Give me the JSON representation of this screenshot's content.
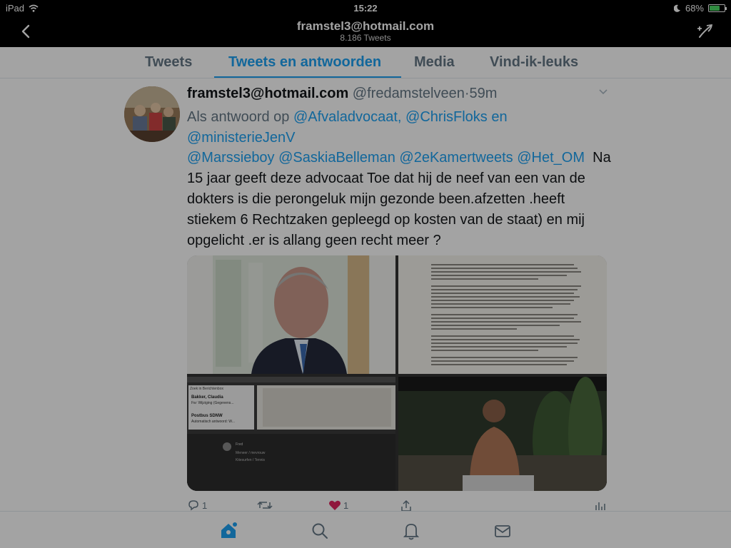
{
  "status_bar": {
    "device": "iPad",
    "time": "15:22",
    "battery": "68%",
    "battery_level": 0.68
  },
  "nav": {
    "title": "framstel3@hotmail.com",
    "subtitle": "8.186 Tweets"
  },
  "tabs": [
    {
      "label": "Tweets",
      "active": false
    },
    {
      "label": "Tweets en antwoorden",
      "active": true
    },
    {
      "label": "Media",
      "active": false
    },
    {
      "label": "Vind-ik-leuks",
      "active": false
    }
  ],
  "tweet": {
    "display_name": "framstel3@hotmail.com",
    "handle": "@fredamstelveen",
    "time": "59m",
    "reply_prefix": "Als antwoord op",
    "reply_mentions": [
      "@Afvaladvocaat,",
      "@ChrisFloks",
      "en",
      "@ministerieJenV"
    ],
    "body_mentions": [
      "@Marssieboy",
      "@SaskiaBelleman",
      "@2eKamertweets",
      "@Het_OM"
    ],
    "body_text": "Na 15 jaar geeft deze advocaat Toe dat hij de neef van een van de dokters is die perongeluk mijn gezonde been.afzetten .heeft stiekem 6 Rechtzaken gepleegd op kosten van de staat) en mij opgelicht .er is allang geen recht meer ?",
    "actions": {
      "reply_count": "1",
      "retweet_count": "",
      "like_count": "1"
    }
  },
  "media_thumbs": {
    "screenshot_list_items": [
      "Bakker, Claudia",
      "Fw: Wijziging (Gegevens...",
      "Postbus SDNW",
      "Automatisch antwoord: W..."
    ],
    "screenshot_search": "Zoek in Berichtenbox"
  },
  "colors": {
    "accent": "#1da1f2",
    "like": "#e0245e",
    "text_secondary": "#657786"
  },
  "icons": [
    "back-icon",
    "compose-icon",
    "caret-down-icon",
    "reply-icon",
    "retweet-icon",
    "heart-icon",
    "share-icon",
    "analytics-icon",
    "home-icon",
    "search-icon",
    "notifications-icon",
    "messages-icon"
  ]
}
